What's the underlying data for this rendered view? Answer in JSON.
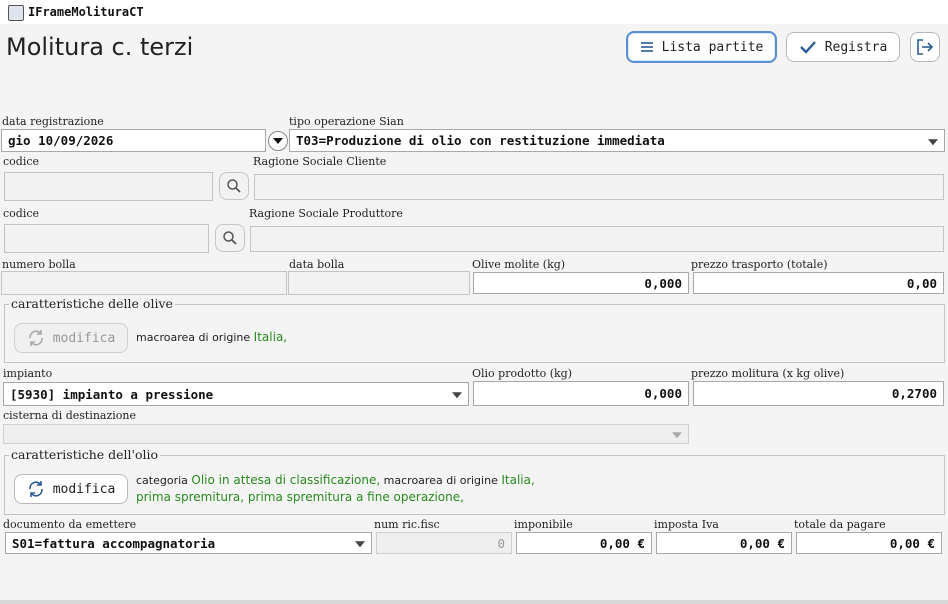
{
  "window": {
    "title": "IFrameMolituraCT"
  },
  "page": {
    "title": "Molitura c. terzi"
  },
  "toolbar": {
    "lista_partite_label": "Lista partite",
    "registra_label": "Registra"
  },
  "form": {
    "data_registrazione": {
      "label": "data registrazione",
      "value": "gio 10/09/2026"
    },
    "tipo_operazione": {
      "label": "tipo operazione Sian",
      "value": "T03=Produzione di olio con restituzione immediata"
    },
    "cliente": {
      "codice_label": "codice",
      "codice_value": "",
      "ragione_label": "Ragione Sociale Cliente",
      "ragione_value": ""
    },
    "produttore": {
      "codice_label": "codice",
      "codice_value": "",
      "ragione_label": "Ragione Sociale Produttore",
      "ragione_value": ""
    },
    "numero_bolla": {
      "label": "numero bolla",
      "value": ""
    },
    "data_bolla": {
      "label": "data bolla",
      "value": ""
    },
    "olive_molite": {
      "label": "Olive molite (kg)",
      "value": "0,000"
    },
    "prezzo_trasporto": {
      "label": "prezzo trasporto (totale)",
      "value": "0,00"
    },
    "caratteristiche_olive": {
      "title": "caratteristiche delle olive",
      "modifica_label": "modifica",
      "macroarea_label": "macroarea di origine",
      "macroarea_value": "Italia,"
    },
    "impianto": {
      "label": "impianto",
      "value": "[5930] impianto a pressione"
    },
    "olio_prodotto": {
      "label": "Olio prodotto (kg)",
      "value": "0,000"
    },
    "prezzo_molitura": {
      "label": "prezzo molitura (x kg olive)",
      "value": "0,2700"
    },
    "cisterna": {
      "label": "cisterna di destinazione",
      "value": ""
    },
    "caratteristiche_olio": {
      "title": "caratteristiche dell'olio",
      "modifica_label": "modifica",
      "categoria_label": "categoria",
      "categoria_value": "Olio in attesa di classificazione,",
      "macroarea_label": "macroarea di origine",
      "macroarea_value": "Italia,",
      "line2": "prima spremitura, prima spremitura a fine operazione,"
    },
    "documento": {
      "label": "documento da emettere",
      "value": "S01=fattura accompagnatoria"
    },
    "num_ric_fisc": {
      "label": "num ric.fisc",
      "value": "0"
    },
    "imponibile": {
      "label": "imponibile",
      "value": "0,00 €"
    },
    "imposta_iva": {
      "label": "imposta Iva",
      "value": "0,00 €"
    },
    "totale": {
      "label": "totale da pagare",
      "value": "0,00 €"
    }
  },
  "colors": {
    "accent": "#5b8fd0",
    "green_text": "#2a8a20",
    "background": "#f4f4f4"
  },
  "icons": [
    "app-icon",
    "list-icon",
    "check-icon",
    "exit-icon",
    "search-icon",
    "refresh-icon",
    "chevron-down-icon"
  ]
}
